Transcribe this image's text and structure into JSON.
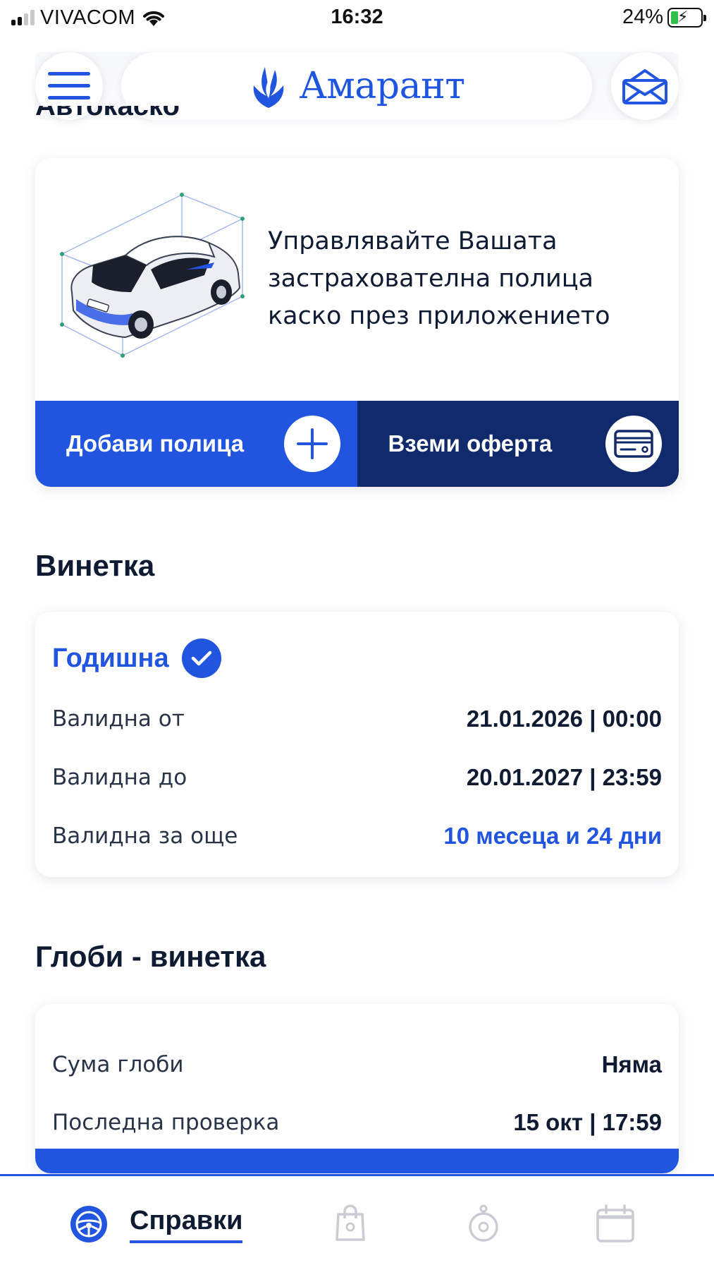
{
  "status_bar": {
    "carrier": "VIVACOM",
    "time": "16:32",
    "battery_percent": "24%",
    "battery_level": 0.24,
    "charging": true
  },
  "header": {
    "brand": "Амарант",
    "menu_icon": "hamburger-menu-icon",
    "mail_icon": "mail-icon"
  },
  "peek_section_title": "Автокаско",
  "kasko": {
    "description": "Управлявайте Вашата застрахователна полица каско през приложението",
    "add_policy_label": "Добави полица",
    "get_offer_label": "Вземи оферта",
    "colors": {
      "primary": "#2155e0",
      "dark": "#112a6c"
    }
  },
  "vignette": {
    "section_title": "Винетка",
    "type_label": "Годишна",
    "rows": [
      {
        "label": "Валидна от",
        "value": "21.01.2026 | 00:00"
      },
      {
        "label": "Валидна до",
        "value": "20.01.2027 | 23:59"
      },
      {
        "label": "Валидна за още",
        "value": "10 месеца и 24 дни"
      }
    ]
  },
  "fines": {
    "section_title": "Глоби - винетка",
    "rows": [
      {
        "label": "Сума глоби",
        "value": "Няма"
      },
      {
        "label": "Последна проверка",
        "value": "15 окт | 17:59"
      }
    ]
  },
  "bottom_nav": {
    "active_label": "Справки",
    "items": [
      "steering-wheel-icon",
      "shopping-bag-icon",
      "stopwatch-icon",
      "calendar-icon"
    ]
  }
}
